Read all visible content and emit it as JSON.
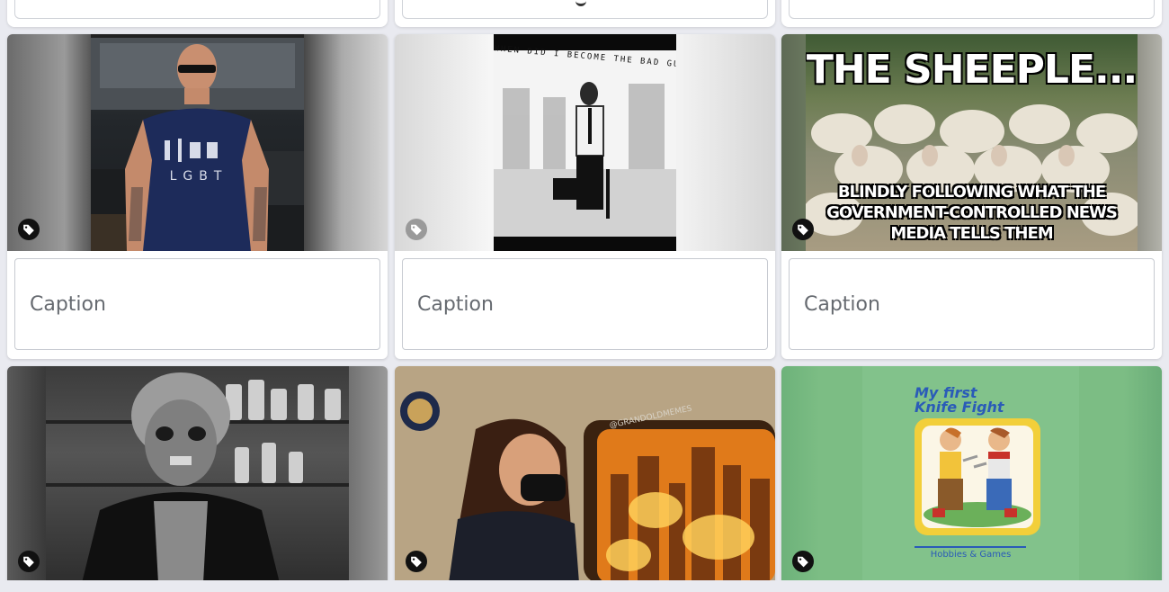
{
  "caption_placeholder": "Caption",
  "cards": [
    {
      "image": "man-in-lgbt-tshirt",
      "shirt_text": "LGBT"
    },
    {
      "image": "man-with-briefcase-vhs",
      "overlay_text": "WHEN DID I BECOME THE BAD GUY"
    },
    {
      "image": "sheeple-meme",
      "top_text": "THE SHEEPLE...",
      "bottom_text_1": "BLINDLY FOLLOWING WHAT THE",
      "bottom_text_2": "GOVERNMENT-CONTROLLED NEWS",
      "bottom_text_3": "MEDIA TELLS THEM"
    },
    {
      "image": "they-live-skeleton-woman"
    },
    {
      "image": "woman-plane-window-city-fire",
      "window_text": "@GRANDOLDMEMES"
    },
    {
      "image": "my-first-knife-fight",
      "title_1": "My first",
      "title_2": "Knife Fight",
      "footer": "Hobbies & Games"
    }
  ],
  "colors": {
    "background": "#e9eaf0",
    "card": "#ffffff",
    "caption_border": "#c7cad1",
    "caption_text": "#666a70"
  },
  "icons": {
    "tag": "tag-icon"
  }
}
